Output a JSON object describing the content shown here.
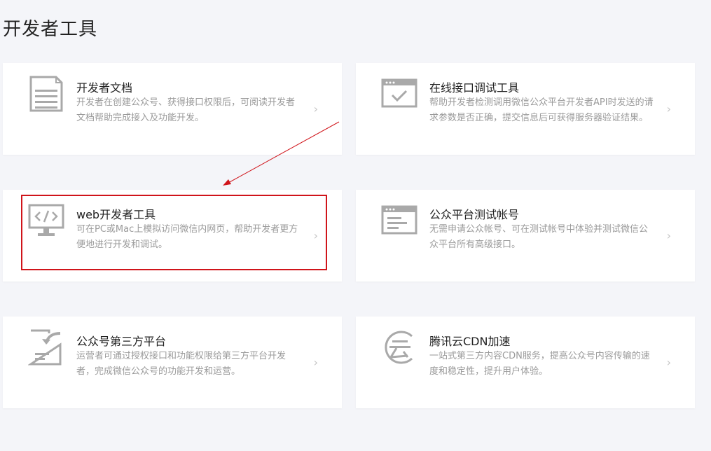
{
  "page": {
    "title": "开发者工具"
  },
  "cards": [
    {
      "title": "开发者文档",
      "desc": "开发者在创建公众号、获得接口权限后，可阅读开发者文档帮助完成接入及功能开发。",
      "icon": "document-icon"
    },
    {
      "title": "在线接口调试工具",
      "desc": "帮助开发者检测调用微信公众平台开发者API时发送的请求参数是否正确，提交信息后可获得服务器验证结果。",
      "icon": "browser-check-icon"
    },
    {
      "title": "web开发者工具",
      "desc": "可在PC或Mac上模拟访问微信内网页，帮助开发者更方便地进行开发和调试。",
      "icon": "monitor-code-icon"
    },
    {
      "title": "公众平台测试帐号",
      "desc": "无需申请公众帐号、可在测试帐号中体验并测试微信公众平台所有高级接口。",
      "icon": "browser-window-icon"
    },
    {
      "title": "公众号第三方平台",
      "desc": "运营者可通过授权接口和功能权限给第三方平台开发者，完成微信公众号的功能开发和运营。",
      "icon": "document-share-icon"
    },
    {
      "title": "腾讯云CDN加速",
      "desc": "一站式第三方内容CDN服务，提高公众号内容传输的速度和稳定性，提升用户体验。",
      "icon": "cloud-yun-icon"
    }
  ],
  "chevron": "›",
  "colors": {
    "annotation": "#d0141a",
    "icon": "#a9a9a9"
  }
}
